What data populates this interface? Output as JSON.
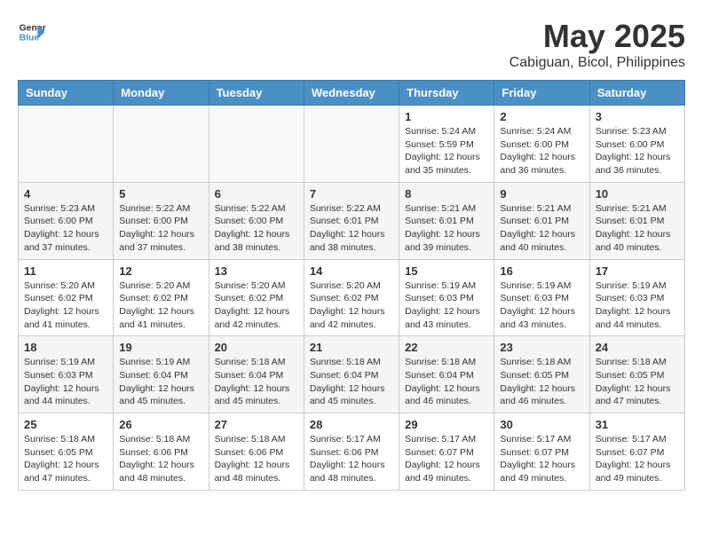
{
  "header": {
    "logo_line1": "General",
    "logo_line2": "Blue",
    "title": "May 2025",
    "subtitle": "Cabiguan, Bicol, Philippines"
  },
  "weekdays": [
    "Sunday",
    "Monday",
    "Tuesday",
    "Wednesday",
    "Thursday",
    "Friday",
    "Saturday"
  ],
  "weeks": [
    [
      {
        "day": "",
        "info": ""
      },
      {
        "day": "",
        "info": ""
      },
      {
        "day": "",
        "info": ""
      },
      {
        "day": "",
        "info": ""
      },
      {
        "day": "1",
        "info": "Sunrise: 5:24 AM\nSunset: 5:59 PM\nDaylight: 12 hours and 35 minutes."
      },
      {
        "day": "2",
        "info": "Sunrise: 5:24 AM\nSunset: 6:00 PM\nDaylight: 12 hours and 36 minutes."
      },
      {
        "day": "3",
        "info": "Sunrise: 5:23 AM\nSunset: 6:00 PM\nDaylight: 12 hours and 36 minutes."
      }
    ],
    [
      {
        "day": "4",
        "info": "Sunrise: 5:23 AM\nSunset: 6:00 PM\nDaylight: 12 hours and 37 minutes."
      },
      {
        "day": "5",
        "info": "Sunrise: 5:22 AM\nSunset: 6:00 PM\nDaylight: 12 hours and 37 minutes."
      },
      {
        "day": "6",
        "info": "Sunrise: 5:22 AM\nSunset: 6:00 PM\nDaylight: 12 hours and 38 minutes."
      },
      {
        "day": "7",
        "info": "Sunrise: 5:22 AM\nSunset: 6:01 PM\nDaylight: 12 hours and 38 minutes."
      },
      {
        "day": "8",
        "info": "Sunrise: 5:21 AM\nSunset: 6:01 PM\nDaylight: 12 hours and 39 minutes."
      },
      {
        "day": "9",
        "info": "Sunrise: 5:21 AM\nSunset: 6:01 PM\nDaylight: 12 hours and 40 minutes."
      },
      {
        "day": "10",
        "info": "Sunrise: 5:21 AM\nSunset: 6:01 PM\nDaylight: 12 hours and 40 minutes."
      }
    ],
    [
      {
        "day": "11",
        "info": "Sunrise: 5:20 AM\nSunset: 6:02 PM\nDaylight: 12 hours and 41 minutes."
      },
      {
        "day": "12",
        "info": "Sunrise: 5:20 AM\nSunset: 6:02 PM\nDaylight: 12 hours and 41 minutes."
      },
      {
        "day": "13",
        "info": "Sunrise: 5:20 AM\nSunset: 6:02 PM\nDaylight: 12 hours and 42 minutes."
      },
      {
        "day": "14",
        "info": "Sunrise: 5:20 AM\nSunset: 6:02 PM\nDaylight: 12 hours and 42 minutes."
      },
      {
        "day": "15",
        "info": "Sunrise: 5:19 AM\nSunset: 6:03 PM\nDaylight: 12 hours and 43 minutes."
      },
      {
        "day": "16",
        "info": "Sunrise: 5:19 AM\nSunset: 6:03 PM\nDaylight: 12 hours and 43 minutes."
      },
      {
        "day": "17",
        "info": "Sunrise: 5:19 AM\nSunset: 6:03 PM\nDaylight: 12 hours and 44 minutes."
      }
    ],
    [
      {
        "day": "18",
        "info": "Sunrise: 5:19 AM\nSunset: 6:03 PM\nDaylight: 12 hours and 44 minutes."
      },
      {
        "day": "19",
        "info": "Sunrise: 5:19 AM\nSunset: 6:04 PM\nDaylight: 12 hours and 45 minutes."
      },
      {
        "day": "20",
        "info": "Sunrise: 5:18 AM\nSunset: 6:04 PM\nDaylight: 12 hours and 45 minutes."
      },
      {
        "day": "21",
        "info": "Sunrise: 5:18 AM\nSunset: 6:04 PM\nDaylight: 12 hours and 45 minutes."
      },
      {
        "day": "22",
        "info": "Sunrise: 5:18 AM\nSunset: 6:04 PM\nDaylight: 12 hours and 46 minutes."
      },
      {
        "day": "23",
        "info": "Sunrise: 5:18 AM\nSunset: 6:05 PM\nDaylight: 12 hours and 46 minutes."
      },
      {
        "day": "24",
        "info": "Sunrise: 5:18 AM\nSunset: 6:05 PM\nDaylight: 12 hours and 47 minutes."
      }
    ],
    [
      {
        "day": "25",
        "info": "Sunrise: 5:18 AM\nSunset: 6:05 PM\nDaylight: 12 hours and 47 minutes."
      },
      {
        "day": "26",
        "info": "Sunrise: 5:18 AM\nSunset: 6:06 PM\nDaylight: 12 hours and 48 minutes."
      },
      {
        "day": "27",
        "info": "Sunrise: 5:18 AM\nSunset: 6:06 PM\nDaylight: 12 hours and 48 minutes."
      },
      {
        "day": "28",
        "info": "Sunrise: 5:17 AM\nSunset: 6:06 PM\nDaylight: 12 hours and 48 minutes."
      },
      {
        "day": "29",
        "info": "Sunrise: 5:17 AM\nSunset: 6:07 PM\nDaylight: 12 hours and 49 minutes."
      },
      {
        "day": "30",
        "info": "Sunrise: 5:17 AM\nSunset: 6:07 PM\nDaylight: 12 hours and 49 minutes."
      },
      {
        "day": "31",
        "info": "Sunrise: 5:17 AM\nSunset: 6:07 PM\nDaylight: 12 hours and 49 minutes."
      }
    ]
  ]
}
